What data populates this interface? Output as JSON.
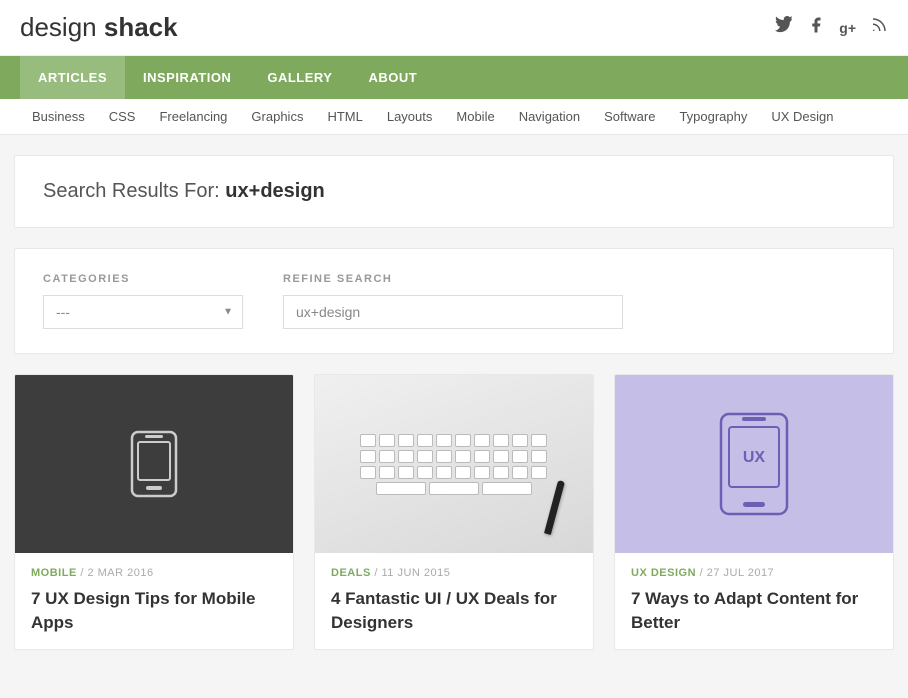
{
  "header": {
    "logo_design": "design",
    "logo_shack": "shack",
    "icons": [
      {
        "name": "twitter-icon",
        "symbol": "𝕏",
        "title": "Twitter"
      },
      {
        "name": "facebook-icon",
        "symbol": "f",
        "title": "Facebook"
      },
      {
        "name": "googleplus-icon",
        "symbol": "g⁺",
        "title": "Google+"
      },
      {
        "name": "rss-icon",
        "symbol": "⊠",
        "title": "RSS"
      }
    ]
  },
  "nav_main": {
    "items": [
      {
        "label": "ARTICLES",
        "active": true
      },
      {
        "label": "INSPIRATION",
        "active": false
      },
      {
        "label": "GALLERY",
        "active": false
      },
      {
        "label": "ABOUT",
        "active": false
      }
    ]
  },
  "nav_sub": {
    "items": [
      "Business",
      "CSS",
      "Freelancing",
      "Graphics",
      "HTML",
      "Layouts",
      "Mobile",
      "Navigation",
      "Software",
      "Typography",
      "UX Design"
    ]
  },
  "search_results": {
    "prefix": "Search Results For:",
    "query": "ux+design"
  },
  "filters": {
    "categories_label": "CATEGORIES",
    "categories_default": "---",
    "refine_label": "REFINE SEARCH",
    "search_value": "ux+design",
    "search_placeholder": "ux+design"
  },
  "articles": [
    {
      "category": "MOBILE",
      "date": "2 MAR 2016",
      "title": "7 UX Design Tips for Mobile Apps",
      "thumb_type": "dark_phone"
    },
    {
      "category": "DEALS",
      "date": "11 JUN 2015",
      "title": "4 Fantastic UI / UX Deals for Designers",
      "thumb_type": "wireframe"
    },
    {
      "category": "UX DESIGN",
      "date": "27 JUL 2017",
      "title": "7 Ways to Adapt Content for Better",
      "thumb_type": "purple_phone"
    }
  ]
}
